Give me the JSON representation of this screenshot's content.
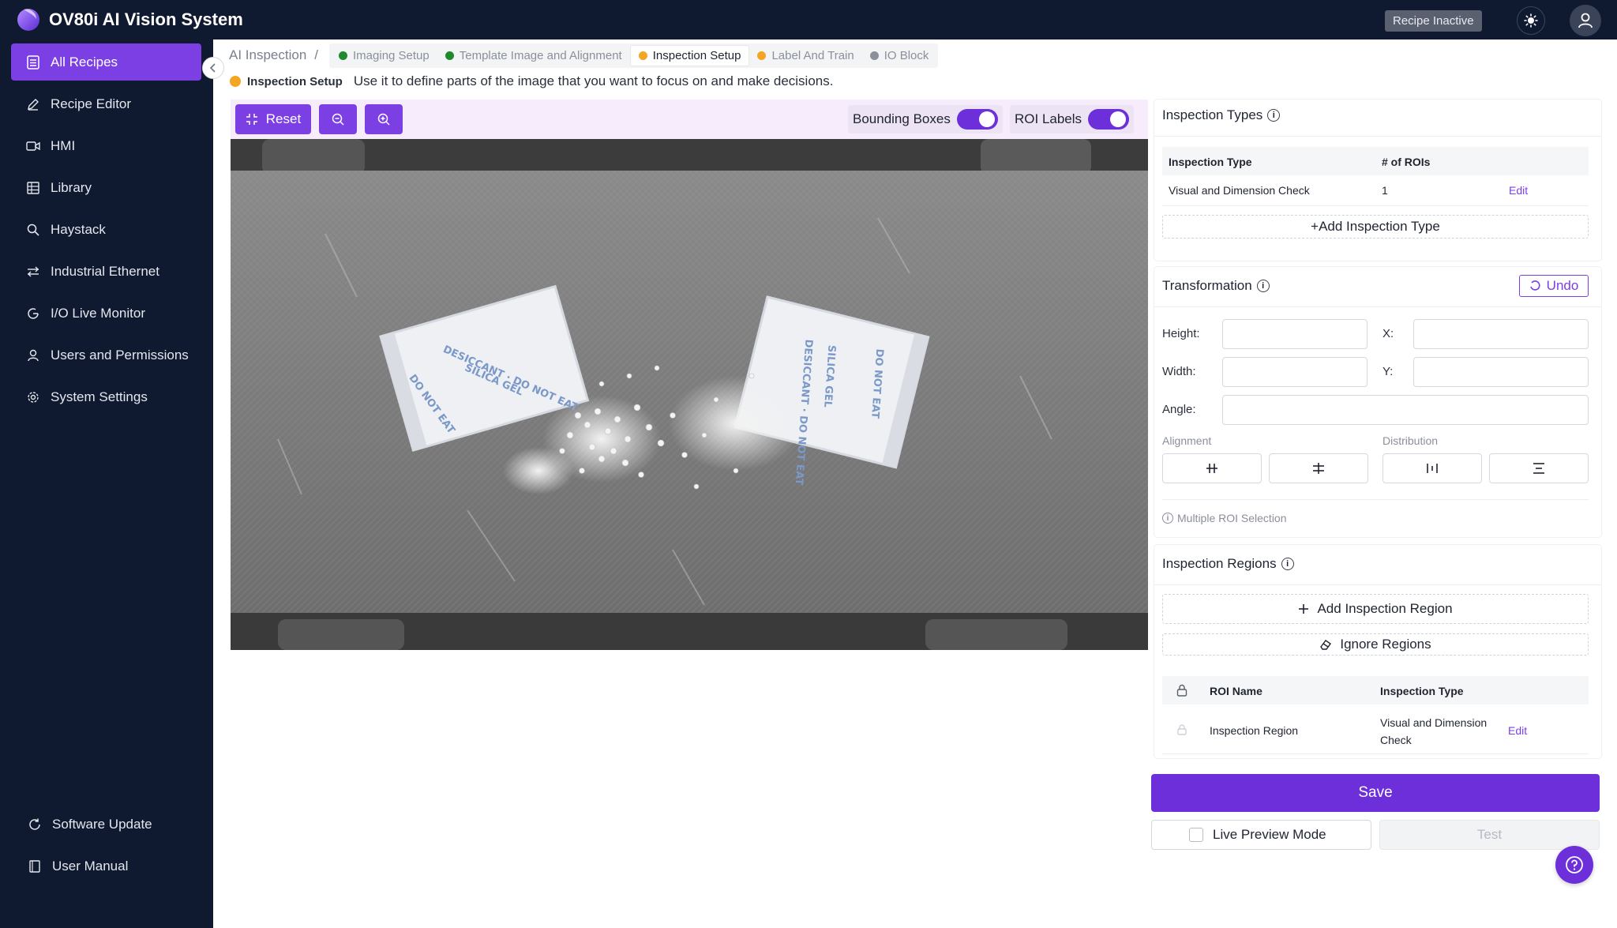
{
  "app": {
    "title": "OV80i AI Vision System",
    "recipe_status": "Recipe Inactive"
  },
  "sidebar": {
    "items": [
      {
        "label": "All Recipes",
        "icon": "list-icon",
        "active": true
      },
      {
        "label": "Recipe Editor",
        "icon": "pencil-icon"
      },
      {
        "label": "HMI",
        "icon": "video-icon"
      },
      {
        "label": "Library",
        "icon": "grid-icon"
      },
      {
        "label": "Haystack",
        "icon": "search-icon"
      },
      {
        "label": "Industrial Ethernet",
        "icon": "network-icon"
      },
      {
        "label": "I/O Live Monitor",
        "icon": "monitor-icon"
      },
      {
        "label": "Users and Permissions",
        "icon": "user-icon"
      },
      {
        "label": "System Settings",
        "icon": "gear-icon"
      }
    ],
    "bottom": [
      {
        "label": "Software Update",
        "icon": "refresh-icon"
      },
      {
        "label": "User Manual",
        "icon": "book-icon"
      }
    ]
  },
  "breadcrumb": {
    "root": "AI Inspection",
    "separator": "/",
    "steps": [
      {
        "label": "Imaging Setup",
        "color": "#1e8a2e"
      },
      {
        "label": "Template Image and Alignment",
        "color": "#1e8a2e"
      },
      {
        "label": "Inspection Setup",
        "color": "#f5a524",
        "active": true
      },
      {
        "label": "Label And Train",
        "color": "#f5a524"
      },
      {
        "label": "IO Block",
        "color": "#8a8f9a"
      }
    ]
  },
  "subtitle": {
    "label": "Inspection Setup",
    "text": "Use it to define parts of the image that you want to focus on and make decisions."
  },
  "toolbar": {
    "reset_label": "Reset",
    "bounding_boxes_label": "Bounding Boxes",
    "roi_labels_label": "ROI Labels"
  },
  "inspection_types": {
    "title": "Inspection Types",
    "headers": [
      "Inspection Type",
      "# of ROIs"
    ],
    "rows": [
      {
        "type": "Visual and Dimension Check",
        "count": "1",
        "action": "Edit"
      }
    ],
    "add_label": "+Add Inspection Type"
  },
  "transformation": {
    "title": "Transformation",
    "undo_label": "Undo",
    "height_label": "Height:",
    "width_label": "Width:",
    "x_label": "X:",
    "y_label": "Y:",
    "angle_label": "Angle:",
    "alignment_label": "Alignment",
    "distribution_label": "Distribution",
    "multi_select_note": "Multiple ROI Selection"
  },
  "inspection_regions": {
    "title": "Inspection Regions",
    "add_label": "Add Inspection Region",
    "ignore_label": "Ignore Regions",
    "headers": [
      "ROI Name",
      "Inspection Type"
    ],
    "rows": [
      {
        "name": "Inspection Region",
        "type": "Visual and Dimension Check",
        "action": "Edit"
      }
    ]
  },
  "actions": {
    "save_label": "Save",
    "live_preview_label": "Live Preview Mode",
    "test_label": "Test"
  },
  "colors": {
    "accent": "#7b3fe4",
    "sidebar_bg": "#0f1a30",
    "success": "#1e8a2e",
    "warning": "#f5a524"
  }
}
